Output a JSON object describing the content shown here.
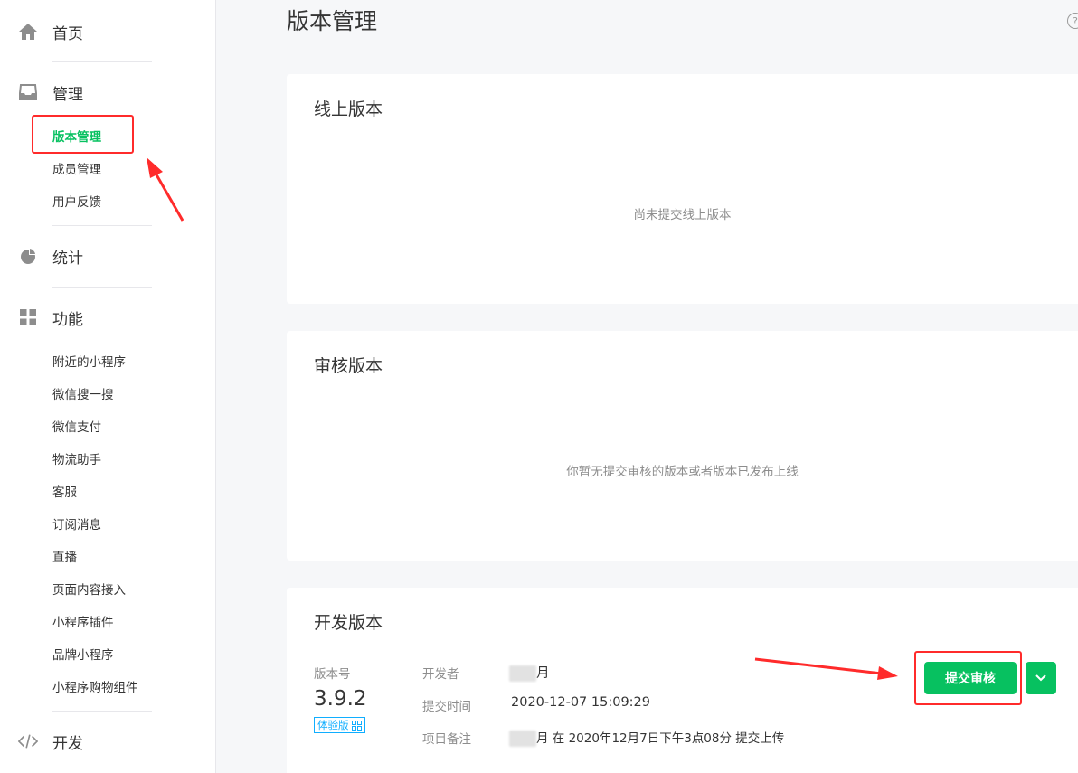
{
  "sidebar": {
    "home": "首页",
    "manage": "管理",
    "manage_items": [
      "版本管理",
      "成员管理",
      "用户反馈"
    ],
    "stats": "统计",
    "features": "功能",
    "feature_items": [
      "附近的小程序",
      "微信搜一搜",
      "微信支付",
      "物流助手",
      "客服",
      "订阅消息",
      "直播",
      "页面内容接入",
      "小程序插件",
      "品牌小程序",
      "小程序购物组件"
    ],
    "dev": "开发"
  },
  "page": {
    "title": "版本管理",
    "help": "?"
  },
  "online": {
    "title": "线上版本",
    "empty": "尚未提交线上版本"
  },
  "review": {
    "title": "审核版本",
    "empty": "你暂无提交审核的版本或者版本已发布上线"
  },
  "dev_version": {
    "title": "开发版本",
    "version_label": "版本号",
    "version": "3.9.2",
    "tag": "体验版",
    "developer_label": "开发者",
    "developer_suffix": "月",
    "submit_time_label": "提交时间",
    "submit_time": "2020-12-07 15:09:29",
    "note_label": "项目备注",
    "note_suffix": "月 在 2020年12月7日下午3点08分 提交上传",
    "submit_button": "提交审核"
  },
  "colors": {
    "brand_green": "#07c160",
    "annotation_red": "#ff2b2b",
    "tag_blue": "#10aeff"
  }
}
